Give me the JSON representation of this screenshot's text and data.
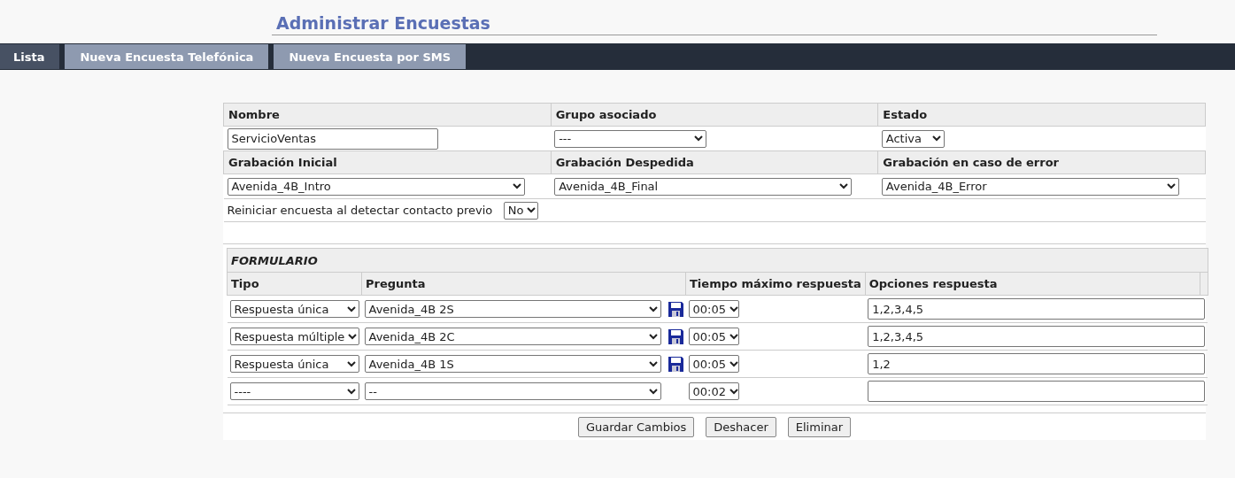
{
  "title": "Administrar Encuestas",
  "tabs": [
    {
      "label": "Lista",
      "selected": true
    },
    {
      "label": "Nueva Encuesta Telefónica",
      "selected": false
    },
    {
      "label": "Nueva Encuesta por SMS",
      "selected": false
    }
  ],
  "survey": {
    "field_rows": [
      [
        {
          "label": "Nombre",
          "kind": "text",
          "value": "ServicioVentas"
        },
        {
          "label": "Grupo asociado",
          "kind": "select",
          "value": "---"
        },
        {
          "label": "Estado",
          "kind": "select",
          "value": "Activa"
        }
      ],
      [
        {
          "label": "Grabación Inicial",
          "kind": "select",
          "value": "Avenida_4B_Intro"
        },
        {
          "label": "Grabación Despedida",
          "kind": "select",
          "value": "Avenida_4B_Final"
        },
        {
          "label": "Grabación en caso de error",
          "kind": "select",
          "value": "Avenida_4B_Error"
        }
      ]
    ],
    "restart": {
      "label": "Reiniciar encuesta al detectar contacto previo",
      "value": "No"
    }
  },
  "form": {
    "title": "FORMULARIO",
    "columns": [
      "Tipo",
      "Pregunta",
      "Tiempo máximo respuesta",
      "Opciones respuesta"
    ],
    "rows": [
      {
        "tipo": "Respuesta única",
        "pregunta": "Avenida_4B 2S",
        "saved": true,
        "tiempo": "00:05",
        "opciones": "1,2,3,4,5"
      },
      {
        "tipo": "Respuesta múltiple",
        "pregunta": "Avenida_4B 2C",
        "saved": true,
        "tiempo": "00:05",
        "opciones": "1,2,3,4,5"
      },
      {
        "tipo": "Respuesta única",
        "pregunta": "Avenida_4B 1S",
        "saved": true,
        "tiempo": "00:05",
        "opciones": "1,2"
      },
      {
        "tipo": "----",
        "pregunta": "--",
        "saved": false,
        "tiempo": "00:02",
        "opciones": ""
      }
    ]
  },
  "buttons": [
    "Guardar Cambios",
    "Deshacer",
    "Eliminar"
  ]
}
